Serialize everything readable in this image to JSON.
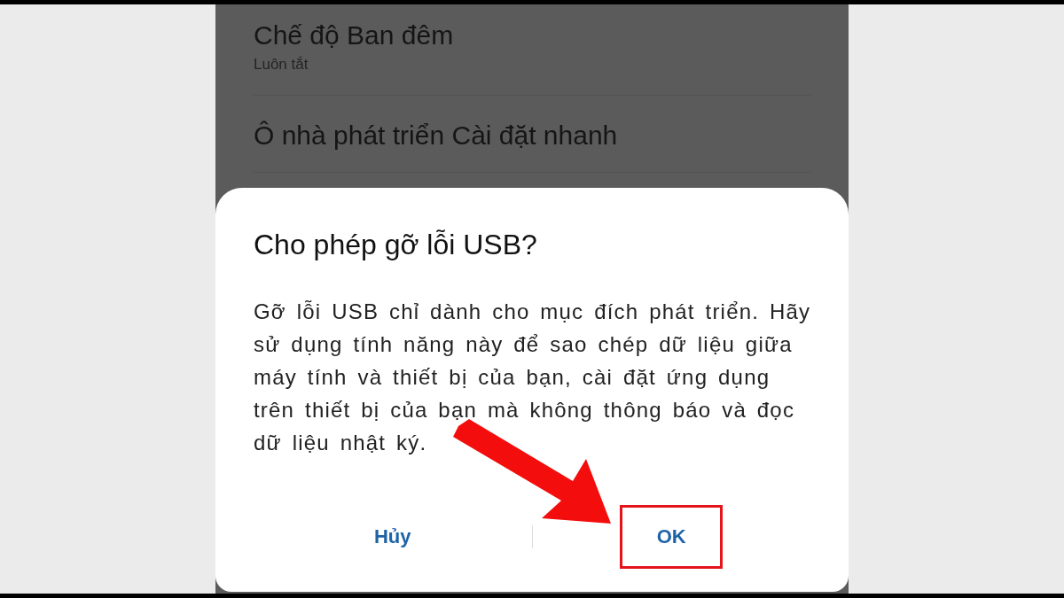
{
  "settings_items": [
    {
      "title": "Chế độ Ban đêm",
      "subtitle": "Luôn tắt"
    },
    {
      "title": "Ô nhà phát triển Cài đặt nhanh"
    }
  ],
  "dialog": {
    "title": "Cho phép gỡ lỗi USB?",
    "message": "Gỡ lỗi USB chỉ dành cho mục đích phát triển. Hãy sử dụng tính năng này để sao chép dữ liệu giữa máy tính và thiết bị của bạn, cài đặt ứng dụng trên thiết bị của bạn mà không thông báo và đọc dữ liệu nhật ký.",
    "buttons": [
      {
        "label": "Hủy",
        "highlighted": false
      },
      {
        "label": "OK",
        "highlighted": true
      }
    ]
  }
}
